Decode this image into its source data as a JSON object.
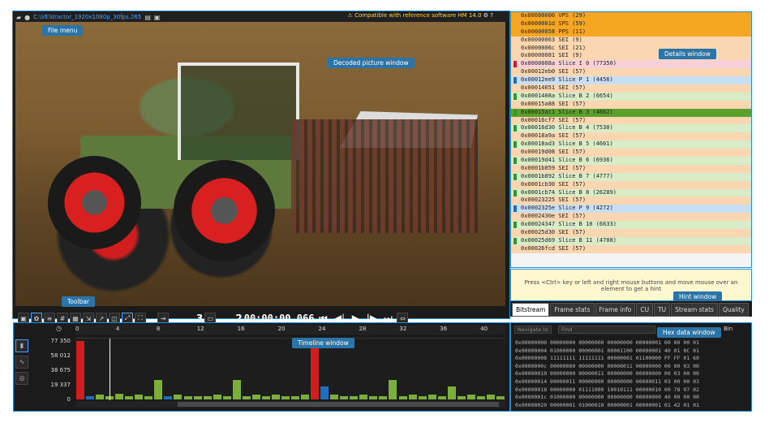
{
  "topbar": {
    "filename": "C:\\VEStractor_1920x1080p_30fps.265",
    "compat": "Compatible with reference software HM 14.0"
  },
  "callouts": {
    "file_menu": "File menu",
    "decoded": "Decoded picture window",
    "details": "Details window",
    "toolbar": "Toolbar",
    "timeline": "Timeline window",
    "hint": "Hint window",
    "hex": "Hex data window"
  },
  "toolbar": {
    "frame_num": "3",
    "frame_idx": "2",
    "timecode": "00:00:00,066"
  },
  "timeline": {
    "ticks": [
      "0",
      "4",
      "8",
      "12",
      "16",
      "20",
      "24",
      "28",
      "32",
      "36",
      "40"
    ],
    "ylabels": [
      "77 350",
      "58 012",
      "38 675",
      "19 337",
      "0"
    ]
  },
  "details": {
    "rows": [
      {
        "t": "0x00000000 VPS (29)",
        "c": "#f5a623",
        "m": ""
      },
      {
        "t": "0x0000001d SPS (59)",
        "c": "#f5a623",
        "m": ""
      },
      {
        "t": "0x00000058 PPS (11)",
        "c": "#f5a623",
        "m": ""
      },
      {
        "t": "0x00000063 SEI (9)",
        "c": "#fad7b0",
        "m": ""
      },
      {
        "t": "0x0000006c SEI (21)",
        "c": "#fad7b0",
        "m": ""
      },
      {
        "t": "0x00000081 SEI (9)",
        "c": "#fad7b0",
        "m": ""
      },
      {
        "t": "0x0000008a Slice I 0 (77350)",
        "c": "#f8d0d8",
        "m": "#d01e1e"
      },
      {
        "t": "0x00012eb0 SEI (57)",
        "c": "#fad7b0",
        "m": ""
      },
      {
        "t": "0x00012ee9 Slice P 1 (4456)",
        "c": "#c8def5",
        "m": "#1f6fbf"
      },
      {
        "t": "0x00014051 SEI (57)",
        "c": "#fad7b0",
        "m": ""
      },
      {
        "t": "0x0001408a Slice B 2 (6654)",
        "c": "#d8ecc8",
        "m": "#2e9a2e"
      },
      {
        "t": "0x00015a88 SEI (57)",
        "c": "#fad7b0",
        "m": ""
      },
      {
        "t": "0x00015ac1 Slice B 3 (4662)",
        "c": "#5aa02a",
        "m": "#2e9a2e"
      },
      {
        "t": "0x00016cf7 SEI (57)",
        "c": "#fad7b0",
        "m": ""
      },
      {
        "t": "0x00016d30 Slice B 4 (7530)",
        "c": "#d8ecc8",
        "m": "#2e9a2e"
      },
      {
        "t": "0x00018a9a SEI (57)",
        "c": "#fad7b0",
        "m": ""
      },
      {
        "t": "0x00018ad3 Slice B 5 (4661)",
        "c": "#d8ecc8",
        "m": "#2e9a2e"
      },
      {
        "t": "0x00019d08 SEI (57)",
        "c": "#fad7b0",
        "m": ""
      },
      {
        "t": "0x00019d41 Slice B 6 (6936)",
        "c": "#d8ecc8",
        "m": "#2e9a2e"
      },
      {
        "t": "0x0001b859 SEI (57)",
        "c": "#fad7b0",
        "m": ""
      },
      {
        "t": "0x0001b892 Slice B 7 (4777)",
        "c": "#d8ecc8",
        "m": "#2e9a2e"
      },
      {
        "t": "0x0001cb30 SEI (57)",
        "c": "#fad7b0",
        "m": ""
      },
      {
        "t": "0x0001cb74 Slice B 8 (26289)",
        "c": "#d8ecc8",
        "m": "#2e9a2e"
      },
      {
        "t": "0x00023225 SEI (57)",
        "c": "#fad7b0",
        "m": ""
      },
      {
        "t": "0x0002325e Slice P 9 (4272)",
        "c": "#c8def5",
        "m": "#1f6fbf"
      },
      {
        "t": "0x0002430e SEI (57)",
        "c": "#fad7b0",
        "m": ""
      },
      {
        "t": "0x00024347 Slice B 10 (6633)",
        "c": "#d8ecc8",
        "m": "#2e9a2e"
      },
      {
        "t": "0x00025d30 SEI (57)",
        "c": "#fad7b0",
        "m": ""
      },
      {
        "t": "0x00025d69 Slice B 11 (4708)",
        "c": "#d8ecc8",
        "m": "#2e9a2e"
      },
      {
        "t": "0x00026fcd SEI (57)",
        "c": "#fad7b0",
        "m": ""
      }
    ]
  },
  "hint": {
    "text": "Press <Ctrl> key or left and right mouse buttons and move mouse over an element to get a hint"
  },
  "tabs": [
    "Bitstream",
    "Frame stats",
    "Frame info",
    "CU",
    "TU",
    "Stream stats",
    "Quality"
  ],
  "hex": {
    "navigate": "Navigate to",
    "find": "Find",
    "mode": "Bin",
    "rows": [
      "0x00000000  00000000 00000000 00000000 00000001  00 00 00 01",
      "0x00000004  01000000 00000001 00001100 00000001  40 01 0C 01",
      "0x00000008  11111111 11111111 00000001 01100000  FF FF 01 60",
      "0x0000000c  00000000 00000000 00000011 00000000  00 00 03 00",
      "0x00000010  00000000 00000011 00000000 00000000  00 03 00 00",
      "0x00000014  00000011 00000000 00000000 00000011  03 00 00 03",
      "0x00000018  00000000 01111000 10010111 00000010  00 78 97 02",
      "0x0000001c  01000000 00000000 00000000 00000000  40 00 00 00",
      "0x00000020  00000001 01000010 00000001 00000001  01 42 01 01"
    ]
  },
  "chart_data": {
    "type": "bar",
    "x": [
      0,
      1,
      2,
      3,
      4,
      5,
      6,
      7,
      8,
      9,
      10,
      11,
      12,
      13,
      14,
      15,
      16,
      17,
      18,
      19,
      20,
      21,
      22,
      23,
      24,
      25,
      26,
      27,
      28,
      29,
      30,
      31,
      32,
      33,
      34,
      35,
      36,
      37,
      38,
      39,
      40,
      41,
      42,
      43
    ],
    "values": [
      77350,
      4456,
      6654,
      4662,
      7530,
      4661,
      6936,
      4777,
      26289,
      4272,
      6633,
      4708,
      4700,
      4500,
      6900,
      4600,
      26000,
      4400,
      6500,
      4600,
      6900,
      4500,
      4700,
      6600,
      77350,
      17500,
      6500,
      4700,
      4600,
      6800,
      4500,
      4600,
      26200,
      4400,
      6700,
      4600,
      6900,
      4500,
      17000,
      4700,
      6600,
      4600,
      6700,
      4500
    ],
    "colors": [
      "#d01e1e",
      "#1f6fbf",
      "#7ab03a",
      "#7ab03a",
      "#7ab03a",
      "#7ab03a",
      "#7ab03a",
      "#7ab03a",
      "#7ab03a",
      "#1f6fbf",
      "#7ab03a",
      "#7ab03a",
      "#7ab03a",
      "#7ab03a",
      "#7ab03a",
      "#7ab03a",
      "#7ab03a",
      "#7ab03a",
      "#7ab03a",
      "#7ab03a",
      "#7ab03a",
      "#7ab03a",
      "#7ab03a",
      "#7ab03a",
      "#d01e1e",
      "#1f6fbf",
      "#7ab03a",
      "#7ab03a",
      "#7ab03a",
      "#7ab03a",
      "#7ab03a",
      "#7ab03a",
      "#7ab03a",
      "#7ab03a",
      "#7ab03a",
      "#7ab03a",
      "#7ab03a",
      "#7ab03a",
      "#7ab03a",
      "#7ab03a",
      "#7ab03a",
      "#7ab03a",
      "#7ab03a",
      "#7ab03a"
    ],
    "ylim": [
      0,
      77350
    ]
  }
}
